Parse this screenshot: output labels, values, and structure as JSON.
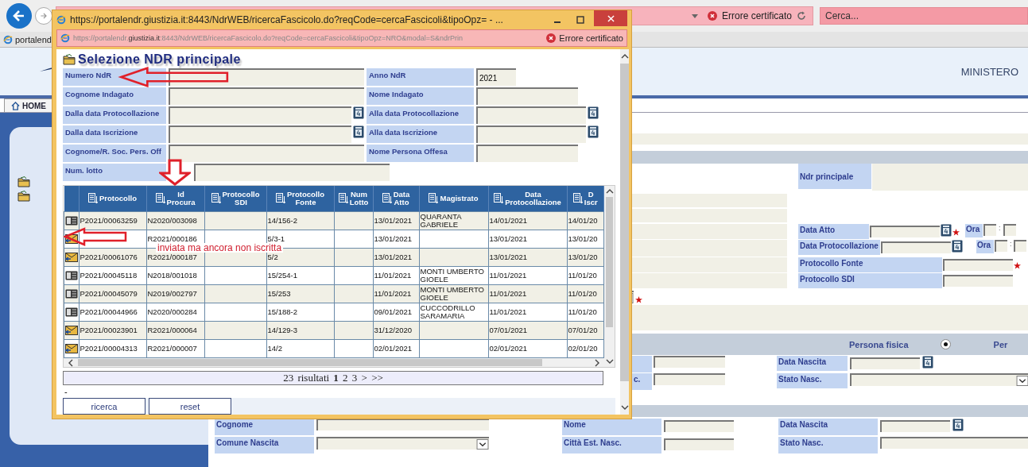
{
  "browser": {
    "cert_error": "Errore certificato",
    "search": {
      "placeholder": "Cerca..."
    },
    "tab": {
      "label": "portalend"
    }
  },
  "page": {
    "header_text": "MINISTERO",
    "nav_tab": "HOME",
    "main_fields": [
      {
        "kind": "wide",
        "label": "Ndr principale"
      },
      {
        "kind": "date_time",
        "label": "Data Atto",
        "required": true,
        "time_label": "Ora",
        "separator": ":"
      },
      {
        "kind": "date_time",
        "label": "Data Protocollazione",
        "required": false,
        "time_label": "Ora",
        "separator": ":"
      },
      {
        "kind": "text",
        "label": "Protocollo Fonte",
        "required": true
      },
      {
        "kind": "text",
        "label": "Protocollo SDI",
        "required": false
      }
    ],
    "type_select": {
      "required": true
    },
    "person_type": {
      "label": "Persona fisica",
      "selected": true,
      "next_option_label": "Per"
    },
    "person_rows": [
      {
        "left": {
          "kind": "text"
        },
        "right": {
          "label": "Data Nascita",
          "kind": "date"
        }
      },
      {
        "left": {
          "label": "c.",
          "kind": "text"
        },
        "right": {
          "label": "Stato Nasc.",
          "kind": "select"
        }
      }
    ],
    "bottom_rows": [
      {
        "fields": [
          {
            "label": "Cognome",
            "kind": "text"
          },
          {
            "label": "Nome",
            "kind": "text"
          },
          {
            "label": "Data Nascita",
            "kind": "date"
          }
        ]
      },
      {
        "fields": [
          {
            "label": "Comune Nascita",
            "kind": "select"
          },
          {
            "label": "Città Est. Nasc.",
            "kind": "text"
          },
          {
            "label": "Stato Nasc.",
            "kind": "text"
          }
        ]
      }
    ]
  },
  "popup": {
    "title": "https://portalendr.giustizia.it:8443/NdrWEB/ricercaFascicolo.do?reqCode=cercaFascicoli&tipoOpz= - ...",
    "address": "https://portalendr.**giustizia.it**:8443/NdrWEB/ricercaFascicolo.do?reqCode=cercaFascicoli&tipoOpz=NRO&modal=S&ndrPrin",
    "cert_error": "Errore certificato",
    "heading": "Selezione NDR principale",
    "filters": [
      {
        "left": {
          "label": "Numero NdR",
          "kind": "text"
        },
        "right": {
          "label": "Anno NdR",
          "kind": "short",
          "value": "2021"
        }
      },
      {
        "left": {
          "label": "Cognome Indagato",
          "kind": "text"
        },
        "right": {
          "label": "Nome Indagato",
          "kind": "text"
        }
      },
      {
        "left": {
          "label": "Dalla data Protocollazione",
          "kind": "date"
        },
        "right": {
          "label": "Alla data Protocollazione",
          "kind": "date"
        }
      },
      {
        "left": {
          "label": "Dalla data Iscrizione",
          "kind": "date"
        },
        "right": {
          "label": "Alla data Iscrizione",
          "kind": "date"
        }
      },
      {
        "left": {
          "label": "Cognome/R. Soc. Pers. Off",
          "kind": "text"
        },
        "right": {
          "label": "Nome Persona Offesa",
          "kind": "text"
        }
      },
      {
        "left": {
          "label": "Num. lotto",
          "kind": "wide"
        }
      }
    ],
    "columns": [
      "Protocollo",
      "Id Procura",
      "Protocollo SDI",
      "Protocollo Fonte",
      "Num Lotto",
      "Data Atto",
      "Magistrato",
      "Data Protocollazione",
      "D Iscr"
    ],
    "rows": [
      {
        "kind": "document",
        "cells": [
          "P2021/00063259",
          "N2020/003098",
          null,
          "14/156-2",
          null,
          "13/01/2021",
          "QUARANTA GABRIELE",
          "14/01/2021",
          "14/01/20"
        ]
      },
      {
        "kind": "envelope",
        "cells": [
          null,
          "R2021/000186",
          null,
          "5/3-1",
          null,
          "13/01/2021",
          null,
          "13/01/2021",
          "13/01/20"
        ]
      },
      {
        "kind": "envelope",
        "cells": [
          "P2021/00061076",
          "R2021/000187",
          null,
          "5/2",
          null,
          "13/01/2021",
          null,
          "13/01/2021",
          "13/01/20"
        ]
      },
      {
        "kind": "document",
        "cells": [
          "P2021/00045118",
          "N2018/001018",
          null,
          "15/254-1",
          null,
          "11/01/2021",
          "MONTI UMBERTO GIOELE",
          "11/01/2021",
          "11/01/20"
        ]
      },
      {
        "kind": "document",
        "cells": [
          "P2021/00045079",
          "N2019/002797",
          null,
          "15/253",
          null,
          "11/01/2021",
          "MONTI UMBERTO GIOELE",
          "11/01/2021",
          "11/01/20"
        ]
      },
      {
        "kind": "document",
        "cells": [
          "P2021/00044966",
          "N2020/000284",
          null,
          "15/188-2",
          null,
          "09/01/2021",
          "CUCCODRILLO SARAMARIA",
          "11/01/2021",
          "11/01/20"
        ]
      },
      {
        "kind": "envelope",
        "cells": [
          "P2021/00023901",
          "R2021/000064",
          null,
          "14/129-3",
          null,
          "31/12/2020",
          null,
          "07/01/2021",
          "07/01/20"
        ]
      },
      {
        "kind": "envelope",
        "cells": [
          "P2021/00004313",
          "R2021/000007",
          null,
          "14/2",
          null,
          "02/01/2021",
          null,
          "02/01/2021",
          "02/01/20"
        ]
      }
    ],
    "pagination": "23 risultati **1** 2 3 > >>",
    "note": "-",
    "buttons": [
      "ricerca",
      "reset"
    ],
    "annotation": "inviata ma ancora non iscritta"
  }
}
